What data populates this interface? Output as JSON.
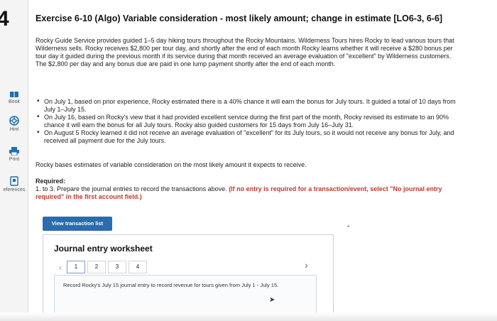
{
  "header": {
    "chapter_number": "4",
    "title": "Exercise 6-10 (Algo) Variable consideration - most likely amount; change in estimate [LO6-3, 6-6]"
  },
  "sidebar": {
    "items": [
      {
        "label": "Book",
        "icon": "book-icon"
      },
      {
        "label": "Hint",
        "icon": "hint-icon"
      },
      {
        "label": "Print",
        "icon": "print-icon"
      },
      {
        "label": "eferences",
        "icon": "references-icon"
      }
    ]
  },
  "intro": {
    "text": "Rocky Guide Service provides guided 1–5 day hiking tours throughout the Rocky Mountains. Wilderness Tours hires Rocky to lead various tours that Wilderness sells. Rocky receives $2,800 per tour day, and shortly after the end of each month Rocky learns whether it will receive a $280 bonus per tour day it guided during the previous month if its service during that month received an average evaluation of \"excellent\" by Wilderness customers. The $2,800 per day and any bonus due are paid in one lump payment shortly after the end of each month."
  },
  "bullets": [
    "On July 1, based on prior experience, Rocky estimated there is a 40% chance it will earn the bonus for July tours. It guided a total of 10 days from July 1–July 15.",
    "On July 16, based on Rocky's view that it had provided excellent service during the first part of the month, Rocky revised its estimate to an 90% chance it will earn the bonus for all July tours. Rocky also guided customers for 15 days from July 16–July 31.",
    "On August 5 Rocky learned it did not receive an average evaluation of \"excellent\" for its July tours, so it would not receive any bonus for July, and received all payment due for the July tours."
  ],
  "estimates_text": "Rocky bases estimates of variable consideration on the most likely amount it expects to receive.",
  "required": {
    "label": "Required:",
    "text": "1. to 3. Prepare the journal entries to record the transactions above.",
    "note": "(If no entry is required for a transaction/event, select \"No journal entry required\" in the first account field.)"
  },
  "view_transaction_button": "View transaction list",
  "worksheet": {
    "title": "Journal entry worksheet",
    "pages": [
      "1",
      "2",
      "3",
      "4"
    ],
    "active_page": "1",
    "instruction": "Record Rocky's July 15 journal entry to record revenue for tours given from July 1 - July 15."
  },
  "colors": {
    "button_bg": "#2b6cb0",
    "note_red": "#c0392b"
  }
}
